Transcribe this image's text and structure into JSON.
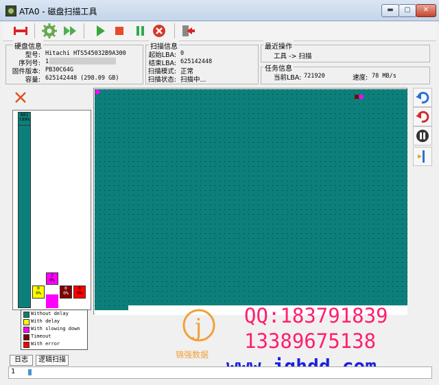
{
  "window": {
    "title": "ATA0 - 磁盘扫描工具"
  },
  "title_buttons": {
    "minimize": "▬",
    "maximize": "▢",
    "close": "✕"
  },
  "disk_info": {
    "heading": "硬盘信息",
    "rows": [
      {
        "label": "型号:",
        "value": "Hitachi HTS545032B9A300"
      },
      {
        "label": "序列号:",
        "value": "1"
      },
      {
        "label": "固件版本:",
        "value": "PB30C64G"
      },
      {
        "label": "容量:",
        "value": "625142448 (298.09 GB)"
      }
    ]
  },
  "scan_info": {
    "heading": "扫描信息",
    "rows": [
      {
        "label": "起始LBA:",
        "value": "0"
      },
      {
        "label": "结束LBA:",
        "value": "625142448"
      },
      {
        "label": "扫描模式:",
        "value": "正常"
      },
      {
        "label": "扫描状态:",
        "value": "扫描中..."
      }
    ]
  },
  "recent_ops": {
    "heading": "最近操作",
    "text": "工具 -> 扫描"
  },
  "task_info": {
    "heading": "任务信息",
    "lba_label": "当前LBA:",
    "lba_value": "721920",
    "speed_label": "速度:",
    "speed_value": "78 MB/s"
  },
  "histogram": {
    "big_bar_label": "881\n(99%",
    "boxes": [
      {
        "label": "0\n0%",
        "color": "#ffff00"
      },
      {
        "label": "2\n0%",
        "color": "#ff00ff"
      },
      {
        "label": "0\n0%",
        "color": "#800000"
      },
      {
        "label": "0\n0%",
        "color": "#ff0000"
      }
    ]
  },
  "legend": [
    {
      "text": "Without delay",
      "color": "#0d7f7b"
    },
    {
      "text": "With delay",
      "color": "#ffff00"
    },
    {
      "text": "With slowing down",
      "color": "#ff00ff"
    },
    {
      "text": "Timeout",
      "color": "#800000"
    },
    {
      "text": "With error",
      "color": "#ff0000"
    }
  ],
  "colors": {
    "block": "#0d7f7b",
    "slow": "#ff00ff",
    "timeout": "#800000",
    "error": "#ff0000"
  },
  "tabs": [
    {
      "label": "日志"
    },
    {
      "label": "逻辑扫描"
    }
  ],
  "status": {
    "text": "1"
  },
  "watermark": {
    "qq": "QQ:183791839",
    "phone": "13389675138",
    "url": "www.jqhdd.com",
    "logo_text": "锦强数据"
  }
}
